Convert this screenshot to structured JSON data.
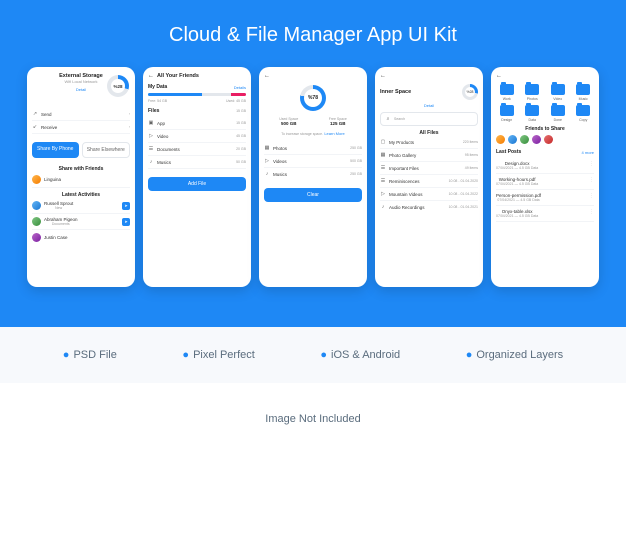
{
  "title": "Cloud & File Manager App UI Kit",
  "features": [
    "PSD File",
    "Pixel Perfect",
    "iOS & Android",
    "Organized Layers"
  ],
  "footnote": "Image Not Included",
  "p1": {
    "storage": "External Storage",
    "wifi": "Wifi Local Network",
    "detail": "Detail",
    "pct": "%28",
    "send": "Send",
    "receive": "Receive",
    "share_phone": "Share By Phone",
    "share_else": "Share Elsewhere",
    "share_friends": "Share with Friends",
    "friend1": "Linguina",
    "latest": "Latest Activities",
    "act1": "Russell Sprout",
    "act1s": "New",
    "act2": "Abraham Pigeon",
    "act2s": "Documents",
    "act3": "Justin Case"
  },
  "p2": {
    "title": "All Your Friends",
    "mydata": "My Data",
    "details": "Details",
    "free": "Free: 54 GB",
    "used": "Used: 45 GB",
    "files": "Files",
    "filesv": "15 GB",
    "r1": "App",
    "r1v": "15 GB",
    "r2": "Video",
    "r2v": "45 GB",
    "r3": "Documents",
    "r3v": "20 GB",
    "r4": "Musics",
    "r4v": "50 GB",
    "addfile": "Add File"
  },
  "p3": {
    "pct": "%78",
    "usedspace": "Used Space",
    "usedv": "500 GB",
    "freespace": "Free Space",
    "freev": "125 GB",
    "increase": "To increase storage space.",
    "learn": "Learn More",
    "r1": "Photos",
    "r1v": "250 GB",
    "r2": "Videos",
    "r2v": "500 GB",
    "r3": "Musics",
    "r3v": "250 GB",
    "clear": "Clear"
  },
  "p4": {
    "title": "Inner Space",
    "pct": "%28",
    "detail": "Detail",
    "search": "Search",
    "allfiles": "All Files",
    "r1": "My Products",
    "r1v": "220 items",
    "r2": "Photo Gallery",
    "r2v": "95 items",
    "r3": "Important Files",
    "r3v": "49 items",
    "r4": "Reminiscences",
    "r4v": "10.08 - 01.04.2020",
    "r5": "Mountain Videos",
    "r5v": "10.08 - 01.04.2022",
    "r6": "Audio Recordings",
    "r6v": "10.08 - 01.04.2021"
  },
  "p5": {
    "folders": [
      "Work",
      "Photos",
      "Video",
      "Music",
      "Design",
      "Data",
      "Done",
      "Copy"
    ],
    "friendshare": "Friends to Share",
    "lastposts": "Last Posts",
    "more": "4 more",
    "f1": "Design.docx",
    "f1s": "07/04/2021 — 4.5 GB Data",
    "f2": "Working-hours.pdf",
    "f2s": "07/04/2021 — 4.5 GB Data",
    "f3": "Person-permission.pdf",
    "f3s": "07/04/2021 — 4.5 GB Data",
    "f4": "Onyx-table.xlsx",
    "f4s": "07/04/2021 — 4.5 GB Data"
  }
}
